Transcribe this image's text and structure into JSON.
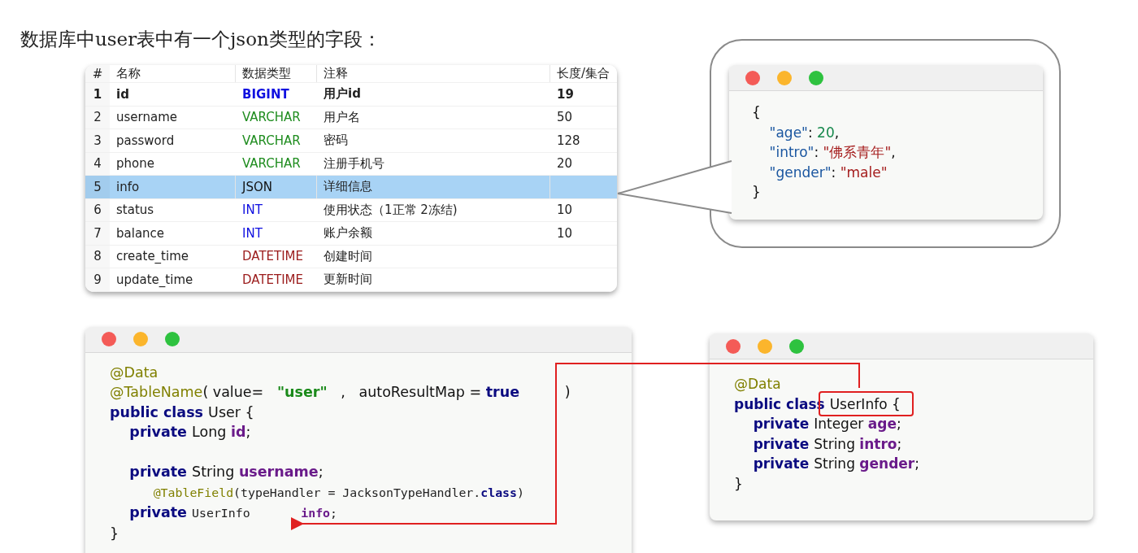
{
  "title": "数据库中user表中有一个json类型的字段：",
  "table": {
    "columns": [
      "#",
      "名称",
      "数据类型",
      "注释",
      "长度/集合"
    ],
    "rows": [
      {
        "num": "1",
        "name": "id",
        "type": "BIGINT",
        "color": "#1010e0",
        "comment": "用户id",
        "length": "19",
        "primary_key": true,
        "selected": false
      },
      {
        "num": "2",
        "name": "username",
        "type": "VARCHAR",
        "color": "#1e8c1e",
        "comment": "用户名",
        "length": "50",
        "primary_key": false,
        "selected": false
      },
      {
        "num": "3",
        "name": "password",
        "type": "VARCHAR",
        "color": "#1e8c1e",
        "comment": "密码",
        "length": "128",
        "primary_key": false,
        "selected": false
      },
      {
        "num": "4",
        "name": "phone",
        "type": "VARCHAR",
        "color": "#1e8c1e",
        "comment": "注册手机号",
        "length": "20",
        "primary_key": false,
        "selected": false
      },
      {
        "num": "5",
        "name": "info",
        "type": "JSON",
        "comment": "详细信息",
        "primary_key": false,
        "selected": true
      },
      {
        "num": "6",
        "name": "status",
        "type": "INT",
        "color": "#1010e0",
        "comment": "使用状态（1正常 2冻结)",
        "length": "10",
        "primary_key": false,
        "selected": false
      },
      {
        "num": "7",
        "name": "balance",
        "type": "INT",
        "color": "#1010e0",
        "comment": "账户余额",
        "length": "10",
        "primary_key": false,
        "selected": false
      },
      {
        "num": "8",
        "name": "create_time",
        "type": "DATETIME",
        "color": "#9b1c1c",
        "comment": "创建时间",
        "primary_key": false,
        "selected": false
      },
      {
        "num": "9",
        "name": "update_time",
        "type": "DATETIME",
        "color": "#9b1c1c",
        "comment": "更新时间",
        "primary_key": false,
        "selected": false
      }
    ]
  },
  "json_window": {
    "lines": [
      {
        "kind": "code",
        "tokens": [
          {
            "text": "{",
            "kind": "punct"
          }
        ]
      },
      {
        "kind": "code",
        "tokens": [
          {
            "text": "    \"age\"",
            "kind": "key"
          },
          {
            "text": ": ",
            "kind": "punct"
          },
          {
            "text": "20",
            "kind": "number"
          },
          {
            "text": ",",
            "kind": "punct"
          }
        ]
      },
      {
        "kind": "code",
        "tokens": [
          {
            "text": "    \"intro\"",
            "kind": "key"
          },
          {
            "text": ": ",
            "kind": "punct"
          },
          {
            "text": "\"佛系青年\"",
            "kind": "string"
          },
          {
            "text": ",",
            "kind": "punct"
          }
        ]
      },
      {
        "kind": "code",
        "tokens": [
          {
            "text": "    \"gender\"",
            "kind": "key"
          },
          {
            "text": ": ",
            "kind": "punct"
          },
          {
            "text": "\"male\"",
            "kind": "string"
          }
        ]
      },
      {
        "kind": "code",
        "tokens": [
          {
            "text": "}",
            "kind": "punct"
          }
        ]
      }
    ]
  },
  "user_window": {
    "lines": [
      {
        "kind": "code",
        "tokens": [
          {
            "text": "@Data",
            "kind": "annotation"
          }
        ]
      },
      {
        "kind": "code",
        "tokens": [
          {
            "text": "@TableName",
            "kind": "annotation"
          },
          {
            "text": "( value=   ",
            "kind": "plain"
          },
          {
            "text": "\"user\"",
            "kind": "string"
          },
          {
            "text": "   ,   autoResultMap = ",
            "kind": "plain"
          },
          {
            "text": "true",
            "kind": "keyword"
          },
          {
            "text": "          )",
            "kind": "plain"
          }
        ]
      },
      {
        "kind": "code",
        "tokens": [
          {
            "text": "public class ",
            "kind": "keyword"
          },
          {
            "text": "User {",
            "kind": "plain"
          }
        ]
      },
      {
        "kind": "code",
        "tokens": [
          {
            "text": "    private ",
            "kind": "keyword"
          },
          {
            "text": "Long ",
            "kind": "plain"
          },
          {
            "text": "id",
            "kind": "field"
          },
          {
            "text": ";",
            "kind": "plain"
          }
        ]
      },
      {
        "kind": "blank"
      },
      {
        "kind": "code",
        "tokens": [
          {
            "text": "    private ",
            "kind": "keyword"
          },
          {
            "text": "String ",
            "kind": "plain"
          },
          {
            "text": "username",
            "kind": "field"
          },
          {
            "text": ";",
            "kind": "plain"
          }
        ]
      },
      {
        "kind": "code",
        "tokens": [
          {
            "text": "      @TableField",
            "kind": "mono_annotation"
          },
          {
            "text": "(typeHandler = JacksonTypeHandler.",
            "kind": "mono_plain"
          },
          {
            "text": "class",
            "kind": "mono_keyword"
          },
          {
            "text": ")",
            "kind": "mono_plain"
          }
        ]
      },
      {
        "kind": "code",
        "tokens": [
          {
            "text": "    private ",
            "kind": "keyword"
          },
          {
            "text": "UserInfo       ",
            "kind": "mono_plain"
          },
          {
            "text": "info",
            "kind": "mono_field"
          },
          {
            "text": ";",
            "kind": "mono_plain"
          }
        ]
      },
      {
        "kind": "code",
        "tokens": [
          {
            "text": "}",
            "kind": "plain"
          }
        ]
      }
    ]
  },
  "userinfo_window": {
    "lines": [
      {
        "kind": "code",
        "tokens": [
          {
            "text": "@Data",
            "kind": "annotation"
          }
        ]
      },
      {
        "kind": "code",
        "tokens": [
          {
            "text": "public class ",
            "kind": "keyword"
          },
          {
            "text": "UserInfo {",
            "kind": "plain",
            "highlighted": true
          }
        ]
      },
      {
        "kind": "code",
        "tokens": [
          {
            "text": "    private ",
            "kind": "keyword"
          },
          {
            "text": "Integer ",
            "kind": "plain"
          },
          {
            "text": "age",
            "kind": "field"
          },
          {
            "text": ";",
            "kind": "plain"
          }
        ]
      },
      {
        "kind": "code",
        "tokens": [
          {
            "text": "    private ",
            "kind": "keyword"
          },
          {
            "text": "String ",
            "kind": "plain"
          },
          {
            "text": "intro",
            "kind": "field"
          },
          {
            "text": ";",
            "kind": "plain"
          }
        ]
      },
      {
        "kind": "code",
        "tokens": [
          {
            "text": "    private ",
            "kind": "keyword"
          },
          {
            "text": "String ",
            "kind": "plain"
          },
          {
            "text": "gender",
            "kind": "field"
          },
          {
            "text": ";",
            "kind": "plain"
          }
        ]
      },
      {
        "kind": "code",
        "tokens": [
          {
            "text": "}",
            "kind": "plain"
          }
        ]
      }
    ]
  }
}
